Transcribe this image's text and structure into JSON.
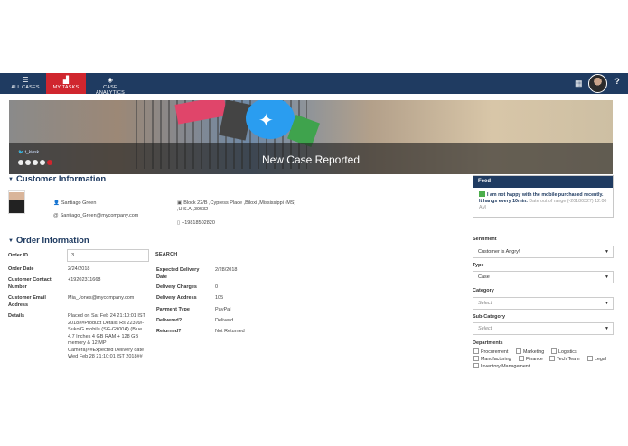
{
  "nav": {
    "tabs": [
      {
        "label": "ALL CASES",
        "icon": "list-icon"
      },
      {
        "label": "MY TASKS",
        "icon": "chart-icon"
      },
      {
        "label": "CASE ANALYTICS",
        "icon": "diamond-icon"
      }
    ],
    "active_color": "#d0262e",
    "bar_color": "#1f3b61"
  },
  "banner": {
    "title": "New Case Reported",
    "link_text": "t_kiosk",
    "slides": 5,
    "active_slide": 5
  },
  "customer": {
    "section_title": "Customer Information",
    "name": "Santiago Green",
    "email": "Santiago_Green@mycompany.com",
    "address": "Block 22/B ,Cypress Place ,Biloxi ,Mississippi (MS) ,U.S.A.,39532",
    "phone": "+19818502820"
  },
  "order": {
    "section_title": "Order Information",
    "order_id_label": "Order ID",
    "order_id_value": "3",
    "search_label": "SEARCH",
    "order_date_label": "Order Date",
    "order_date": "2/24/2018",
    "contact_label": "Customer Contact Number",
    "contact": "+19202311668",
    "email_label": "Customer Email Address",
    "email": "Mia_Jones@mycompany.com",
    "details_label": "Details",
    "details": "Placed on Sat Feb 24 21:10:01 IST 2018##Product Details Rs 22399/- SukoiG mobile (SG-G900A) (Blue 4.7 Inches 4 GB RAM + 128 GB memory & 12 MP Camera)##Expected Delivery date Wed Feb 28 21:10:01 IST 2018##",
    "exp_delivery_label": "Expected Delivery Date",
    "exp_delivery": "2/28/2018",
    "delivery_charges_label": "Delivery Charges",
    "delivery_charges": "0",
    "delivery_address_label": "Delivery Address",
    "delivery_address": "105",
    "payment_type_label": "Payment Type",
    "payment_type": "PayPal",
    "delivered_label": "Delivered?",
    "delivered": "Deliverd",
    "returned_label": "Returned?",
    "returned": "Not Returned"
  },
  "feed": {
    "title": "Feed",
    "message": "I am not happy with the mobile purchased recently. It hangs every 10min.",
    "note": "Date out of range (-20180327) 12:00 AM"
  },
  "classification": {
    "sentiment_label": "Sentiment",
    "sentiment": "Customer is Angry!",
    "type_label": "Type",
    "type": "Case",
    "category_label": "Category",
    "category_placeholder": "Select",
    "subcategory_label": "Sub-Category",
    "subcategory_placeholder": "Select",
    "departments_label": "Departments",
    "departments": [
      "Procurement",
      "Marketing",
      "Logistics",
      "Manufacturing",
      "Finance",
      "Tech Team",
      "Legal",
      "Inventory Management"
    ]
  }
}
